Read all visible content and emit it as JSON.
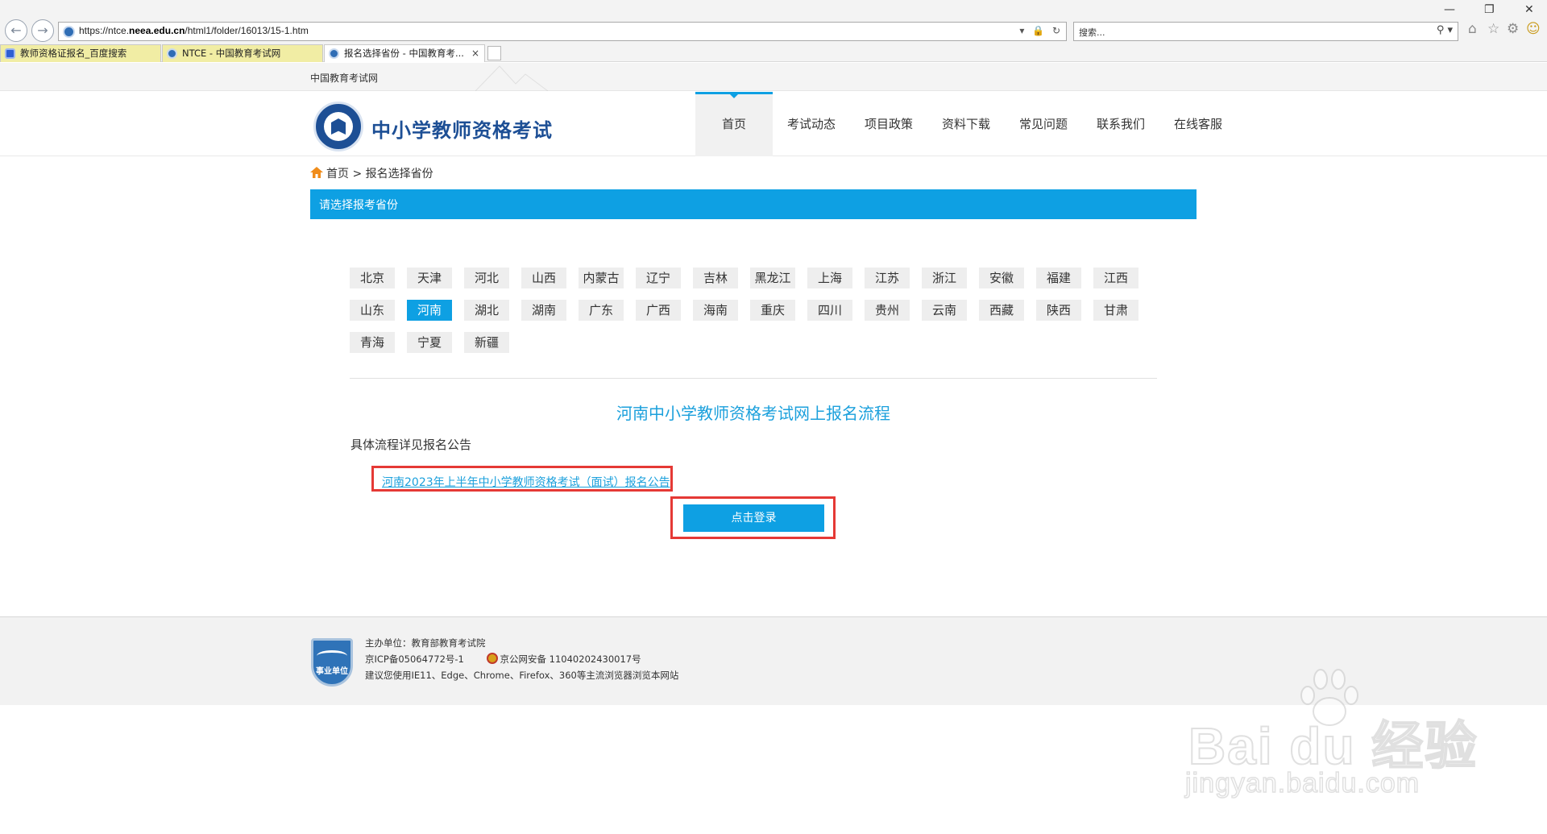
{
  "browser": {
    "url_prefix": "https://ntce.",
    "url_domain": "neea.edu.cn",
    "url_path": "/html1/folder/16013/15-1.htm",
    "addr_tools": "▾ 🔒 ↻",
    "search_placeholder": "搜索...",
    "search_icon": "⚲ ▾",
    "tabs": [
      {
        "label": "教师资格证报名_百度搜索",
        "icon": "baidu-icon"
      },
      {
        "label": "NTCE - 中国教育考试网",
        "icon": "globe-icon"
      },
      {
        "label": "报名选择省份 - 中国教育考...",
        "icon": "globe-icon",
        "close": "×"
      }
    ],
    "nav_back": "←",
    "nav_forward": "→",
    "home": "⌂",
    "favorites": "☆",
    "settings": "⚙",
    "feedback": "☺",
    "win_min": "—",
    "win_restore": "❐",
    "win_close": "✕"
  },
  "page": {
    "topbar_text": "中国教育考试网",
    "logo_title": "中小学教师资格考试",
    "nav": [
      "首页",
      "考试动态",
      "项目政策",
      "资料下载",
      "常见问题",
      "联系我们",
      "在线客服"
    ],
    "breadcrumb": {
      "home": "首页",
      "sep": " > ",
      "current": "报名选择省份"
    },
    "section_title": "请选择报考省份",
    "provinces": [
      [
        "北京",
        "天津",
        "河北",
        "山西",
        "内蒙古",
        "辽宁",
        "吉林",
        "黑龙江",
        "上海",
        "江苏",
        "浙江",
        "安徽",
        "福建",
        "江西"
      ],
      [
        "山东",
        "河南",
        "湖北",
        "湖南",
        "广东",
        "广西",
        "海南",
        "重庆",
        "四川",
        "贵州",
        "云南",
        "西藏",
        "陕西",
        "甘肃"
      ],
      [
        "青海",
        "宁夏",
        "新疆"
      ]
    ],
    "selected_province": "河南",
    "flow_title": "河南中小学教师资格考试网上报名流程",
    "flow_note": "具体流程详见报名公告",
    "notice_link": "河南2023年上半年中小学教师资格考试（面试）报名公告",
    "login_button": "点击登录",
    "accent_color": "#0ea0e3",
    "highlight_color": "#e53935"
  },
  "footer": {
    "badge_text": "事业单位",
    "sponsor": "主办单位：教育部教育考试院",
    "icp": "京ICP备05064772号-1",
    "police": "京公网安备 11040202430017号",
    "browser_tip": "建议您使用IE11、Edge、Chrome、Firefox、360等主流浏览器浏览本网站"
  },
  "watermark": {
    "main": "Bai du 经验",
    "sub": "jingyan.baidu.com"
  }
}
